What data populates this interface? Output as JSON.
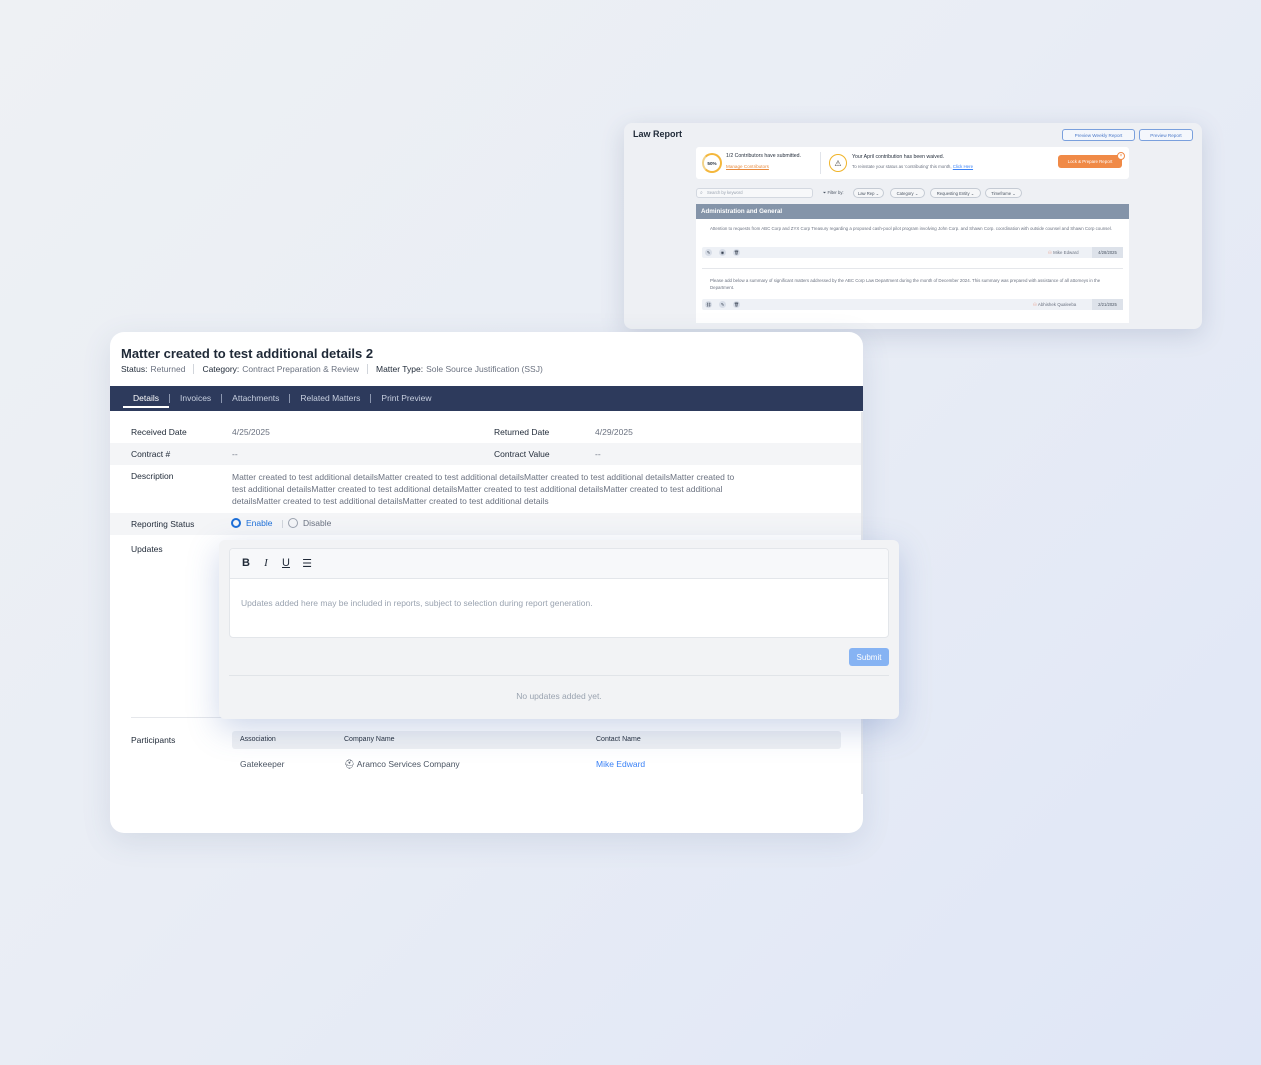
{
  "law_report": {
    "title": "Law Report",
    "preview_weekly_label": "Preview Weekly Report",
    "preview_label": "Preview Report",
    "progress_percent": "50%",
    "contributors_text": "1/2 Contributors have submitted.",
    "manage_contributors": "Manage Contributors",
    "waived_title": "Your April contribution has been waived.",
    "waived_sub": "To reinstate your status as 'contributing' this month,",
    "waived_link": "Click Here",
    "lock_label": "Lock & Prepare Report",
    "lock_badge": "×",
    "search_placeholder": "Search by keyword",
    "filter_label": "Filter by:",
    "filters": [
      "Law Rep",
      "Category",
      "Requesting Entity",
      "Timeframe"
    ],
    "section_title": "Administration and General",
    "entries": [
      {
        "text": "Attention to requests from ABC Corp and ZYX Corp Treasury regarding a proposed cash-pool pilot program involving John Corp. and Shawn Corp. coordination with outside counsel and Shawn Corp counsel.",
        "user": "Mike Edward",
        "date": "4/28/2025"
      },
      {
        "text": "Please add below a summary of significant matters addressed by the ABC Corp Law Department during the month of December 2024. This summary was prepared with assistance of all attorneys in the Department.",
        "user": "Abhishek Qualeeba",
        "date": "2/21/2025"
      }
    ]
  },
  "matter": {
    "title": "Matter created to test additional details 2",
    "status_label": "Status:",
    "status_value": "Returned",
    "category_label": "Category:",
    "category_value": "Contract Preparation & Review",
    "type_label": "Matter Type:",
    "type_value": "Sole Source Justification (SSJ)",
    "tabs": [
      "Details",
      "Invoices",
      "Attachments",
      "Related Matters",
      "Print Preview"
    ],
    "received_label": "Received Date",
    "received_value": "4/25/2025",
    "returned_label": "Returned Date",
    "returned_value": "4/29/2025",
    "contract_label": "Contract #",
    "contract_value": "--",
    "contract_value_label": "Contract Value",
    "contract_value_value": "--",
    "description_label": "Description",
    "description_value": "Matter created to test additional detailsMatter created to test additional detailsMatter created to test additional detailsMatter created to test additional detailsMatter created to test additional detailsMatter created to test additional detailsMatter created to test additional detailsMatter created to test additional detailsMatter created to test additional details",
    "reporting_label": "Reporting Status",
    "reporting_enable": "Enable",
    "reporting_disable": "Disable",
    "reporting_selected": "Enable",
    "updates_label": "Updates",
    "participants_label": "Participants",
    "participants_columns": [
      "Association",
      "Company Name",
      "Contact Name"
    ],
    "participants_rows": [
      {
        "association": "Gatekeeper",
        "company": "Aramco Services Company",
        "contact": "Mike Edward"
      }
    ]
  },
  "editor": {
    "toolbar": [
      "B",
      "I",
      "U",
      "list"
    ],
    "placeholder": "Updates added here may be included in reports, subject to selection during report generation.",
    "submit_label": "Submit",
    "empty_text": "No updates added yet."
  },
  "colors": {
    "tab_bar": "#2d3a5c",
    "accent": "#1d6fd8",
    "orange": "#f08a47",
    "submit": "#86b3f3"
  }
}
